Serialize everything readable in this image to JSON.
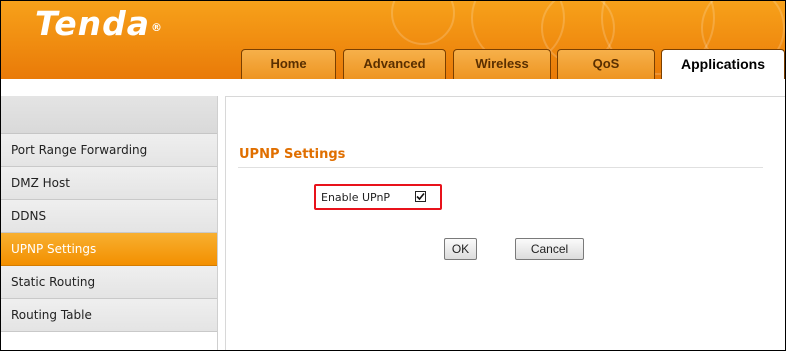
{
  "brand": {
    "logo_text": "Tenda",
    "registered_mark": "®"
  },
  "nav": {
    "tabs": [
      {
        "label": "Home"
      },
      {
        "label": "Advanced"
      },
      {
        "label": "Wireless"
      },
      {
        "label": "QoS"
      },
      {
        "label": "Applications",
        "active": true
      }
    ]
  },
  "sidebar": {
    "items": [
      {
        "label": "Port Range Forwarding"
      },
      {
        "label": "DMZ Host"
      },
      {
        "label": "DDNS"
      },
      {
        "label": "UPNP Settings",
        "active": true
      },
      {
        "label": "Static Routing"
      },
      {
        "label": "Routing Table"
      }
    ]
  },
  "main": {
    "section_title": "UPNP Settings",
    "enable_upnp_label": "Enable UPnP",
    "enable_upnp_checked": true,
    "ok_label": "OK",
    "cancel_label": "Cancel"
  },
  "colors": {
    "header_orange": "#f08c10",
    "accent_text": "#e06f00",
    "highlight_box": "#e8121b",
    "active_sidebar": "#f39000"
  }
}
